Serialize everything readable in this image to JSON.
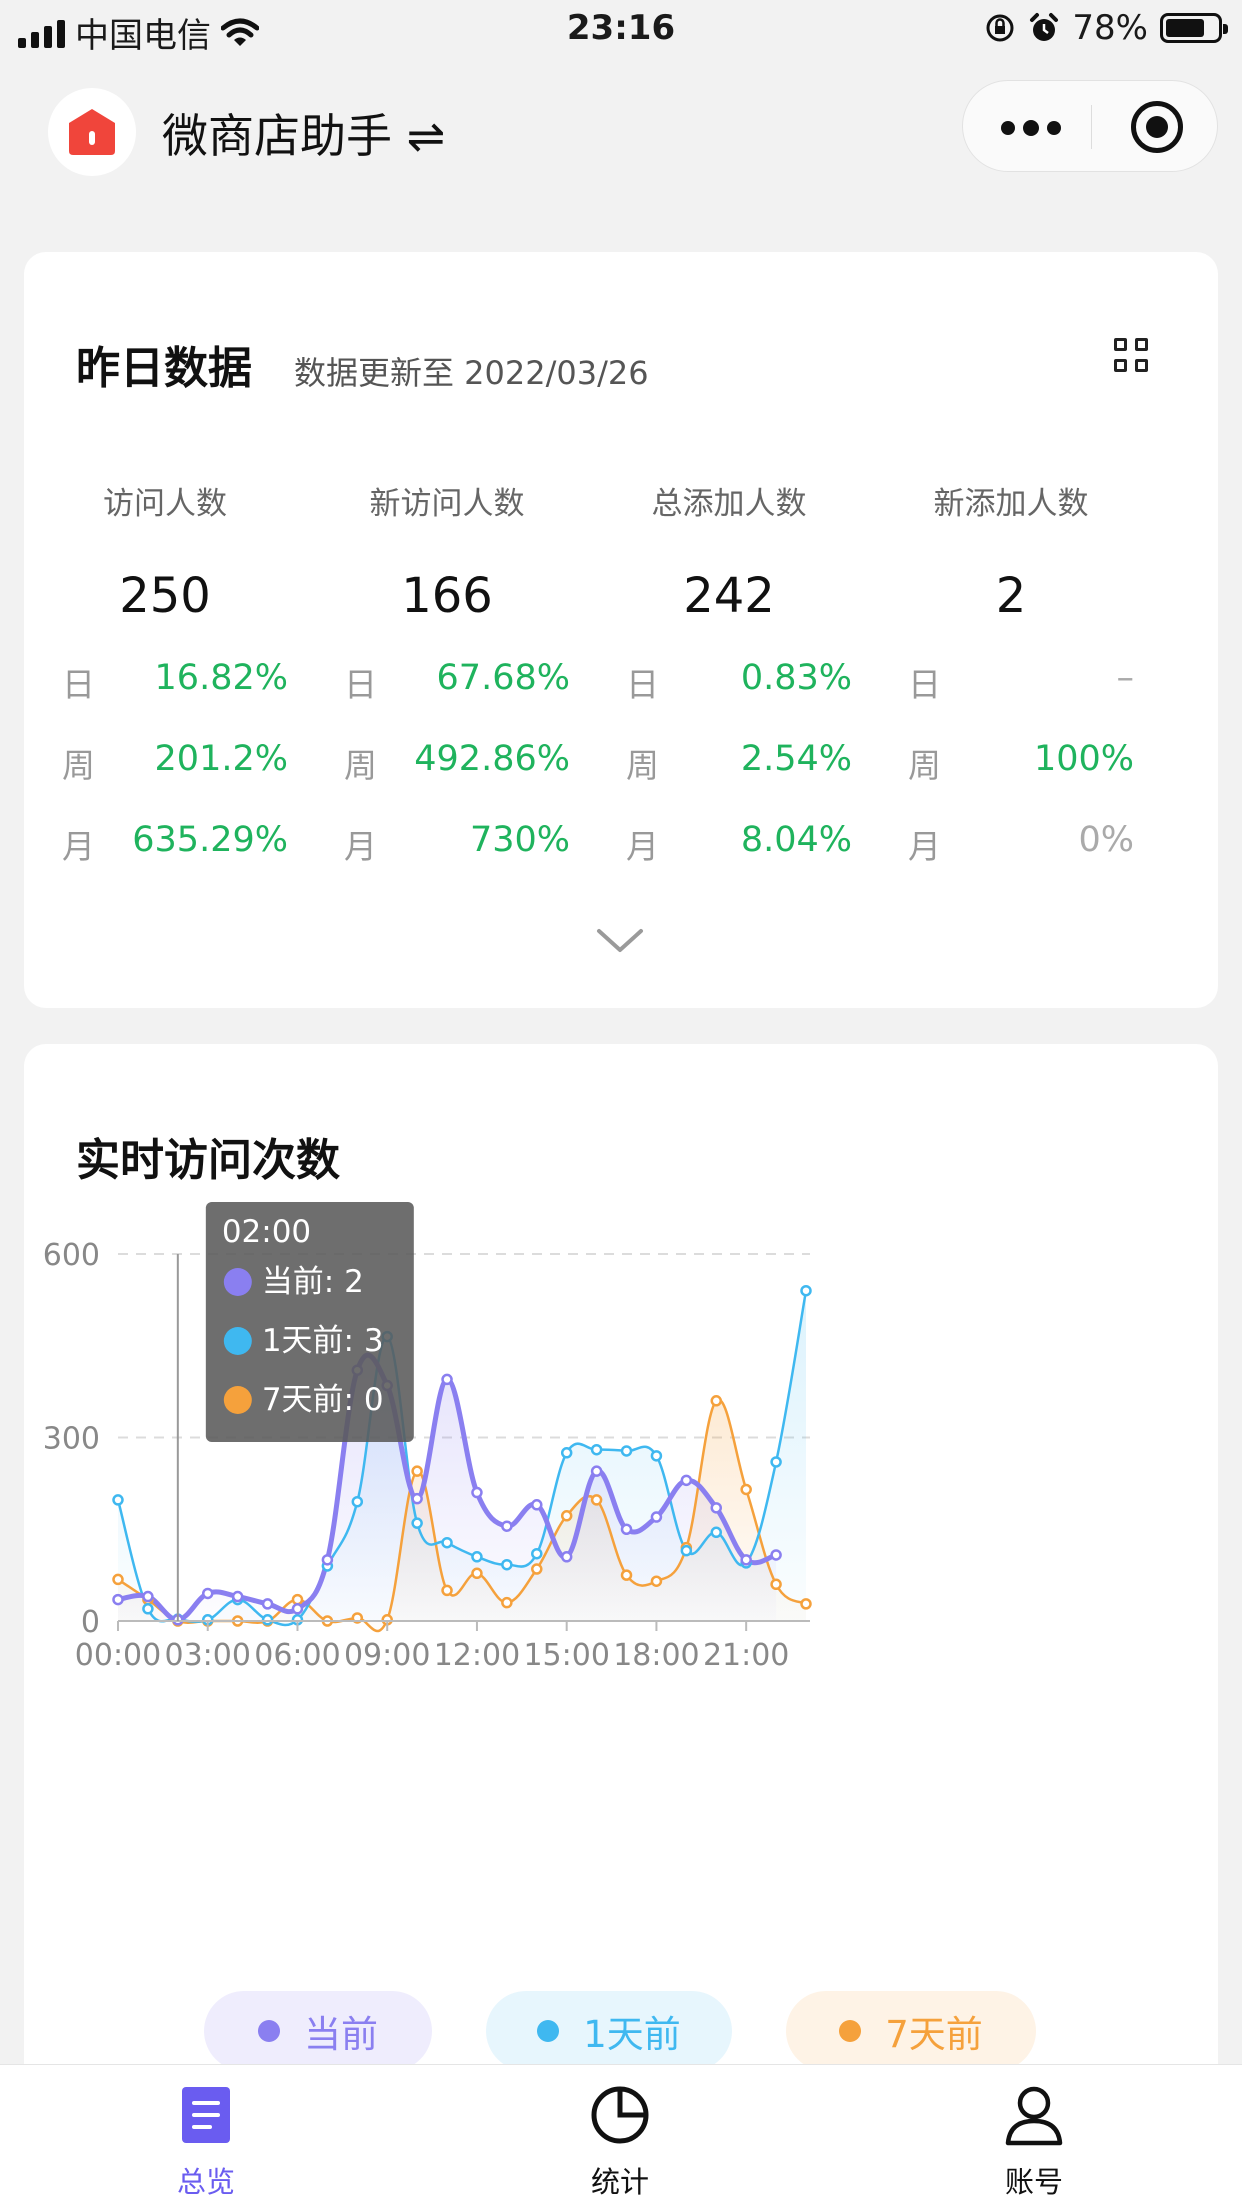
{
  "status_bar": {
    "carrier": "中国电信",
    "time": "23:16",
    "battery": "78%",
    "battery_level": 0.78
  },
  "header": {
    "title": "微商店助手 ⇌"
  },
  "summary": {
    "title": "昨日数据",
    "subtitle": "数据更新至 2022/03/26",
    "metrics": [
      {
        "label": "访问人数",
        "value": "250",
        "rows": [
          {
            "k": "日",
            "v": "16.82%"
          },
          {
            "k": "周",
            "v": "201.2%"
          },
          {
            "k": "月",
            "v": "635.29%"
          }
        ]
      },
      {
        "label": "新访问人数",
        "value": "166",
        "rows": [
          {
            "k": "日",
            "v": "67.68%"
          },
          {
            "k": "周",
            "v": "492.86%"
          },
          {
            "k": "月",
            "v": "730%"
          }
        ]
      },
      {
        "label": "总添加人数",
        "value": "242",
        "rows": [
          {
            "k": "日",
            "v": "0.83%"
          },
          {
            "k": "周",
            "v": "2.54%"
          },
          {
            "k": "月",
            "v": "8.04%"
          }
        ]
      },
      {
        "label": "新添加人数",
        "value": "2",
        "rows": [
          {
            "k": "日",
            "v": "–"
          },
          {
            "k": "周",
            "v": "100%"
          },
          {
            "k": "月",
            "v": "0%"
          }
        ]
      }
    ]
  },
  "realtime": {
    "title": "实时访问次数"
  },
  "colors": {
    "current": "#8a7ff0",
    "day1": "#3fb8f0",
    "day7": "#f5a13c",
    "green": "#1fb35d"
  },
  "chart_data": {
    "type": "line",
    "x": [
      "00:00",
      "01:00",
      "02:00",
      "03:00",
      "04:00",
      "05:00",
      "06:00",
      "07:00",
      "08:00",
      "09:00",
      "10:00",
      "11:00",
      "12:00",
      "13:00",
      "14:00",
      "15:00",
      "16:00",
      "17:00",
      "18:00",
      "19:00",
      "20:00",
      "21:00",
      "22:00",
      "23:00"
    ],
    "xticks": [
      "00:00",
      "03:00",
      "06:00",
      "09:00",
      "12:00",
      "15:00",
      "18:00",
      "21:00"
    ],
    "yticks": [
      "0",
      "300",
      "600"
    ],
    "ylim": [
      0,
      600
    ],
    "series": [
      {
        "name": "当前",
        "values": [
          35,
          40,
          2,
          45,
          40,
          28,
          20,
          100,
          410,
          385,
          200,
          395,
          210,
          155,
          190,
          105,
          245,
          150,
          170,
          230,
          185,
          100,
          108,
          null
        ]
      },
      {
        "name": "1天前",
        "values": [
          198,
          20,
          3,
          2,
          35,
          2,
          2,
          90,
          195,
          465,
          160,
          128,
          105,
          92,
          110,
          275,
          280,
          278,
          270,
          115,
          145,
          95,
          260,
          540
        ]
      },
      {
        "name": "7天前",
        "values": [
          68,
          35,
          0,
          0,
          0,
          0,
          35,
          0,
          5,
          2,
          245,
          50,
          78,
          30,
          85,
          172,
          198,
          75,
          65,
          120,
          360,
          215,
          60,
          28
        ]
      }
    ],
    "tooltip": {
      "x_label": "02:00",
      "rows": [
        "当前: 2",
        "1天前: 3",
        "7天前: 0"
      ]
    }
  },
  "legend": [
    "当前",
    "1天前",
    "7天前"
  ],
  "tabs": [
    {
      "label": "总览",
      "active": true
    },
    {
      "label": "统计"
    },
    {
      "label": "账号"
    }
  ]
}
